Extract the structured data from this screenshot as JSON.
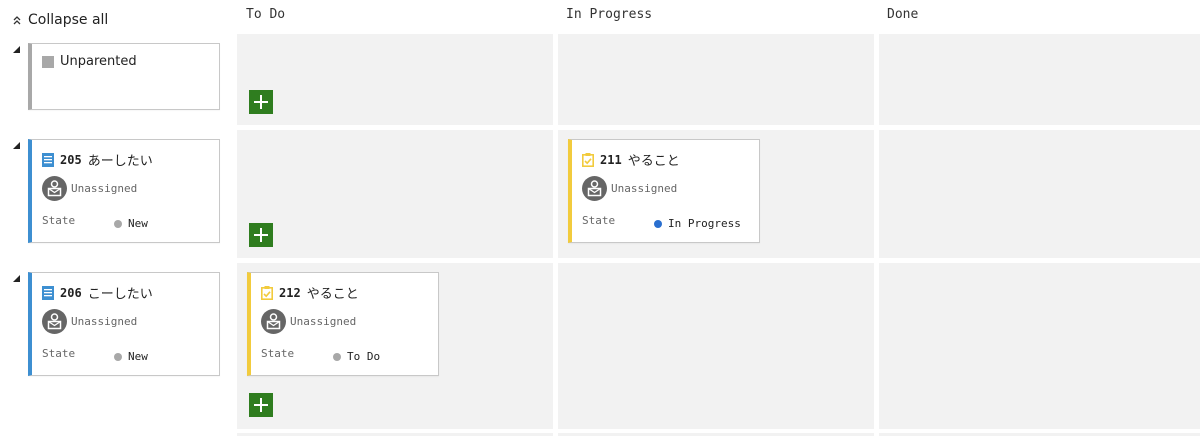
{
  "toolbar": {
    "collapse_all": "Collapse all"
  },
  "columns": [
    "To Do",
    "In Progress",
    "Done"
  ],
  "rows": [
    {
      "parent": {
        "type": "unparented",
        "label": "Unparented"
      }
    },
    {
      "parent": {
        "id": "205",
        "title": "あーしたい",
        "assignee": "Unassigned",
        "state_label": "State",
        "state": "New"
      }
    },
    {
      "parent": {
        "id": "206",
        "title": "こーしたい",
        "assignee": "Unassigned",
        "state_label": "State",
        "state": "New"
      }
    }
  ],
  "tasks": [
    {
      "id": "211",
      "title": "やること",
      "assignee": "Unassigned",
      "state_label": "State",
      "state": "In Progress",
      "column": "In Progress"
    },
    {
      "id": "212",
      "title": "やること",
      "assignee": "Unassigned",
      "state_label": "State",
      "state": "To Do",
      "column": "To Do"
    }
  ],
  "colors": {
    "cell_bg": "#f2f2f2",
    "requirement_accent": "#3d8fd1",
    "task_accent": "#f2cb3d",
    "add_button": "#2f7d1f",
    "state_in_progress": "#2a6fcf",
    "state_new": "#a8a8a8"
  },
  "icons": {
    "collapse": "double-chevron-up-icon",
    "expand_toggle": "triangle-expanded-icon",
    "requirement": "requirement-doc-icon",
    "task": "task-clipboard-icon",
    "avatar": "unassigned-avatar-icon",
    "add": "plus-icon"
  }
}
